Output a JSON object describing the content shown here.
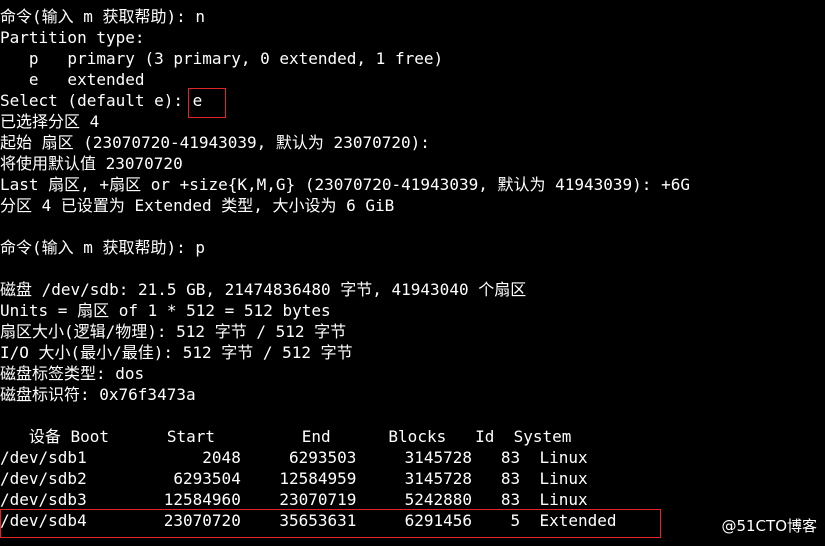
{
  "terminal": {
    "lines": [
      "命令(输入 m 获取帮助): n",
      "Partition type:",
      "   p   primary (3 primary, 0 extended, 1 free)",
      "   e   extended",
      "Select (default e): e",
      "已选择分区 4",
      "起始 扇区 (23070720-41943039, 默认为 23070720):",
      "将使用默认值 23070720",
      "Last 扇区, +扇区 or +size{K,M,G} (23070720-41943039, 默认为 41943039): +6G",
      "分区 4 已设置为 Extended 类型, 大小设为 6 GiB",
      "",
      "命令(输入 m 获取帮助): p",
      "",
      "磁盘 /dev/sdb: 21.5 GB, 21474836480 字节, 41943040 个扇区",
      "Units = 扇区 of 1 * 512 = 512 bytes",
      "扇区大小(逻辑/物理): 512 字节 / 512 字节",
      "I/O 大小(最小/最佳): 512 字节 / 512 字节",
      "磁盘标签类型: dos",
      "磁盘标识符: 0x76f3473a",
      "",
      "   设备 Boot      Start         End      Blocks   Id  System",
      "/dev/sdb1            2048     6293503     3145728   83  Linux",
      "/dev/sdb2         6293504    12584959     3145728   83  Linux",
      "/dev/sdb3        12584960    23070719     5242880   83  Linux",
      "/dev/sdb4        23070720    35653631     6291456    5  Extended"
    ]
  },
  "watermark": "@51CTO博客",
  "colors": {
    "background": "#000000",
    "text": "#ffffff",
    "highlight": "#e0242a"
  }
}
